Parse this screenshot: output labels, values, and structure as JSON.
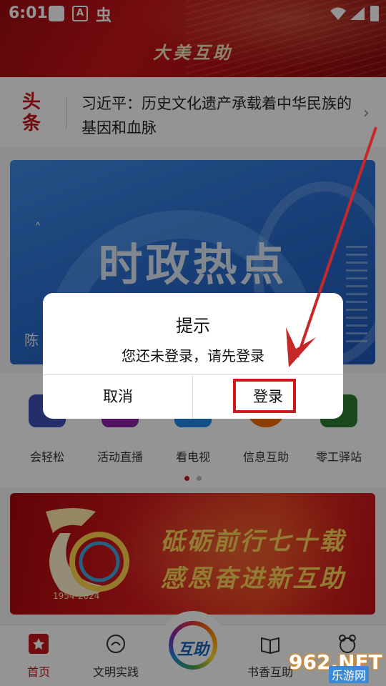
{
  "status_bar": {
    "time": "6:01",
    "a_icon": "A",
    "bug_icon": "虫",
    "icons": [
      "square-icon",
      "a-icon",
      "bug-icon",
      "wifi-icon",
      "signal-icon",
      "battery-icon"
    ]
  },
  "header": {
    "title": "大美互助",
    "brand_color": "#c4161c"
  },
  "headline": {
    "badge": "头\n条",
    "badge_top": "头",
    "badge_bottom": "条",
    "text": "习近平：历史文化遗产承载着中华民族的基因和血脉"
  },
  "banner": {
    "title": "时政热点",
    "caption": "陈",
    "up_glyph": "˄"
  },
  "quick_menu": {
    "items": [
      {
        "label": "会轻松",
        "color": "#3f51b5"
      },
      {
        "label": "活动直播",
        "color": "#8e24aa"
      },
      {
        "label": "看电视",
        "color": "#1e88e5"
      },
      {
        "label": "信息互助",
        "color": "#ef6c00"
      },
      {
        "label": "零工驿站",
        "color": "#2e7d32"
      }
    ],
    "page_count": 2,
    "active_page": 1
  },
  "promo": {
    "line1": "砥砺前行七十载",
    "line2": "感恩奋进新互助",
    "emblem_years": "1954-2024"
  },
  "tab_bar": {
    "items": [
      {
        "label": "首页",
        "active": true
      },
      {
        "label": "文明实践",
        "active": false
      },
      {
        "label": "书香互助",
        "active": false
      },
      {
        "label": "",
        "active": false
      }
    ],
    "center_label": "互助"
  },
  "dialog": {
    "title": "提示",
    "message": "您还未登录，请先登录",
    "cancel": "取消",
    "confirm": "登录"
  },
  "watermark": {
    "top": "962.NET",
    "bottom": "乐游网"
  },
  "accent_colors": {
    "highlight": "#d0161c",
    "overlay": "rgba(0,0,0,0.42)"
  }
}
